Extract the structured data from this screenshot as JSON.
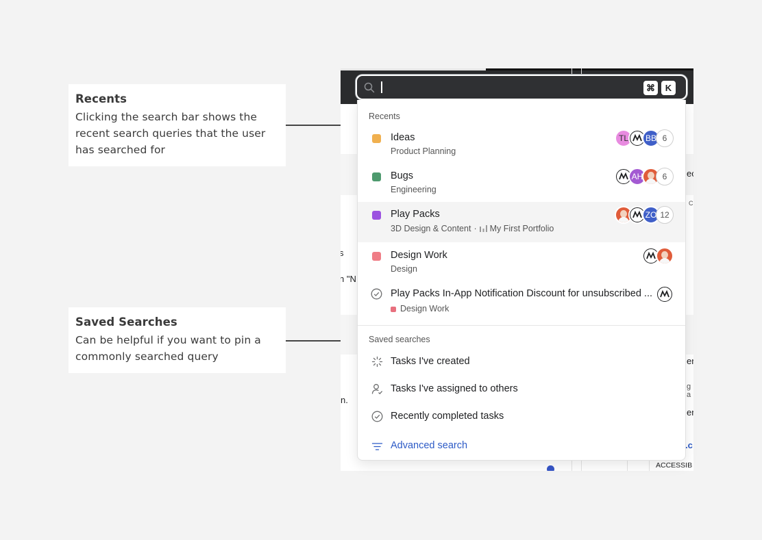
{
  "annotations": {
    "recents": {
      "title": "Recents",
      "body": "Clicking the search bar shows the recent search queries that the user has searched for"
    },
    "saved": {
      "title": "Saved Searches",
      "body": "Can be helpful if you want to pin a commonly searched query"
    }
  },
  "search": {
    "placeholder": "",
    "shortcut_cmd": "⌘",
    "shortcut_key": "K"
  },
  "background_fragments": {
    "r1": "ec",
    "r1b": "C",
    "r2": "s",
    "r3": "n \"N",
    "r4": "n.",
    "r5": "en",
    "r6": "g a",
    "r7": "en",
    "r8": ".c",
    "r9": "ACCESSIB"
  },
  "recents": {
    "label": "Recents",
    "items": [
      {
        "title": "Ideas",
        "subtitle": "Product Planning",
        "color": "#f0b04f",
        "avatars": [
          "TL",
          "mk-icon",
          "BB"
        ],
        "count": "6"
      },
      {
        "title": "Bugs",
        "subtitle": "Engineering",
        "color": "#4e9a6e",
        "avatars": [
          "mk-icon",
          "AH",
          "photo"
        ],
        "count": "6"
      },
      {
        "title": "Play Packs",
        "subtitle": "3D Design & Content",
        "portfolio": "My First Portfolio",
        "color": "#9b51e0",
        "avatars": [
          "photo",
          "mk-icon",
          "ZO"
        ],
        "count": "12"
      },
      {
        "title": "Design Work",
        "subtitle": "Design",
        "color": "#ef7d86",
        "avatars": [
          "mk-icon",
          "photo"
        ]
      },
      {
        "title": "Play Packs In-App Notification Discount for unsubscribed ...",
        "subtitle": "Design Work",
        "avatars": [
          "mk-icon"
        ]
      }
    ]
  },
  "saved": {
    "label": "Saved searches",
    "items": [
      {
        "label": "Tasks I've created",
        "icon": "spinner-icon"
      },
      {
        "label": "Tasks I've assigned to others",
        "icon": "person-check-icon"
      },
      {
        "label": "Recently completed tasks",
        "icon": "check-circle-icon"
      }
    ],
    "advanced": "Advanced search"
  }
}
